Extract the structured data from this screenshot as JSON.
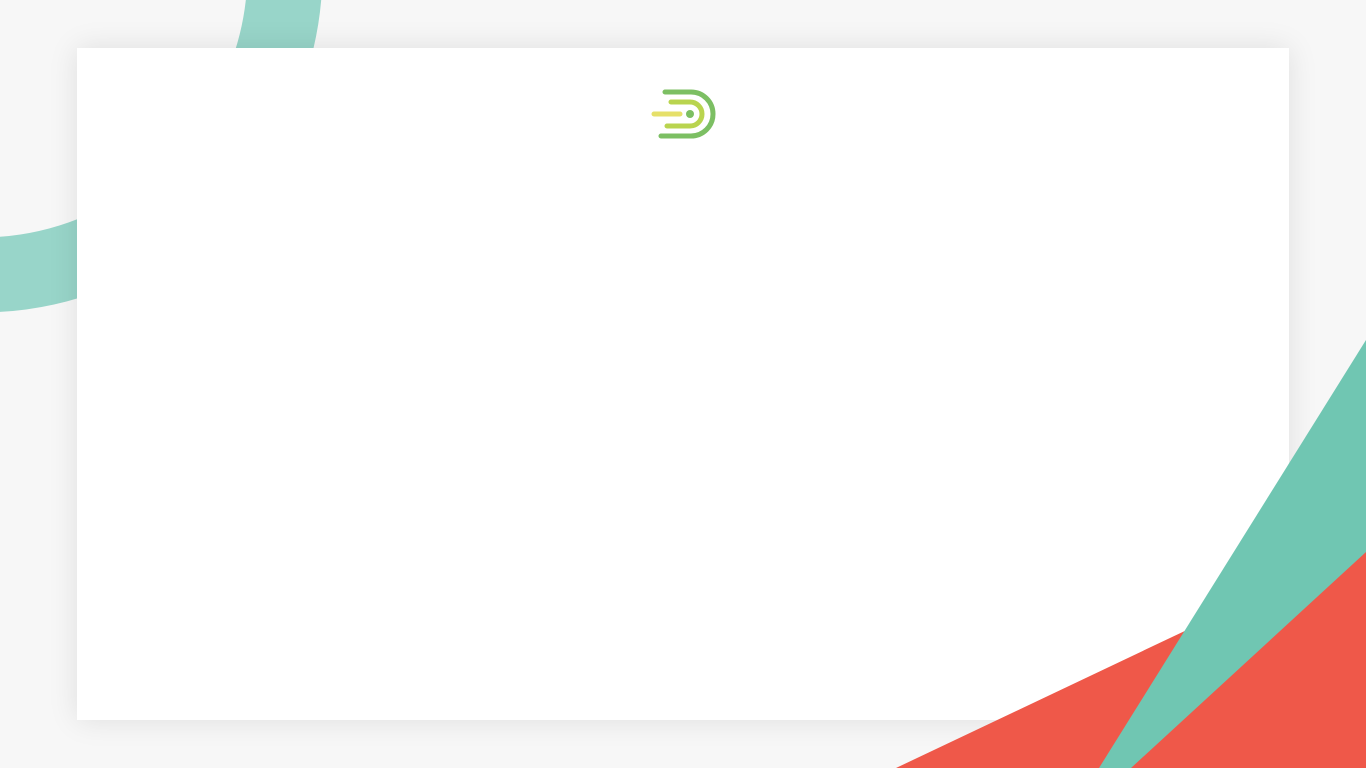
{
  "colors": {
    "page_background": "#f7f7f7",
    "card_background": "#ffffff",
    "teal_arc": "#98d5c9",
    "teal_stripe": "#70c6b2",
    "coral": "#ef5849",
    "logo_green": "#7cbf63",
    "logo_lime": "#b9d44f",
    "logo_yellow": "#e6e06a"
  },
  "icons": {
    "brand_logo": "brand-logo-icon"
  }
}
